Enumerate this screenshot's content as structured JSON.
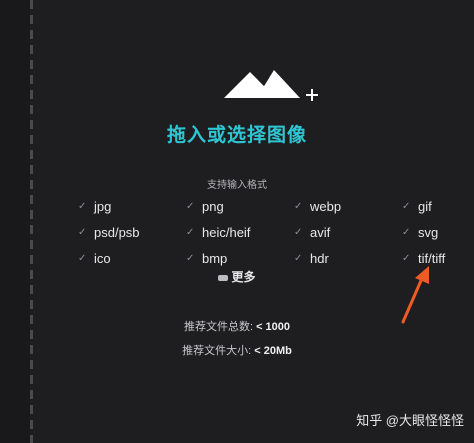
{
  "drop_zone": {
    "title": "拖入或选择图像",
    "formats_label": "支持输入格式",
    "formats": [
      "jpg",
      "png",
      "webp",
      "gif",
      "psd/psb",
      "heic/heif",
      "avif",
      "svg",
      "ico",
      "bmp",
      "hdr",
      "tif/tiff"
    ],
    "more_label": "更多",
    "count_limit_label": "推荐文件总数:",
    "count_limit_value": "< 1000",
    "size_limit_label": "推荐文件大小:",
    "size_limit_value": "< 20Mb"
  },
  "watermark": "知乎 @大眼怪怪怪",
  "colors": {
    "accent": "#2fc6d3",
    "background": "#1e1e20",
    "arrow": "#f05a24"
  },
  "icons": [
    "mountain-upload-icon",
    "plus-icon",
    "check-icon",
    "more-icon",
    "arrow-annotation"
  ]
}
